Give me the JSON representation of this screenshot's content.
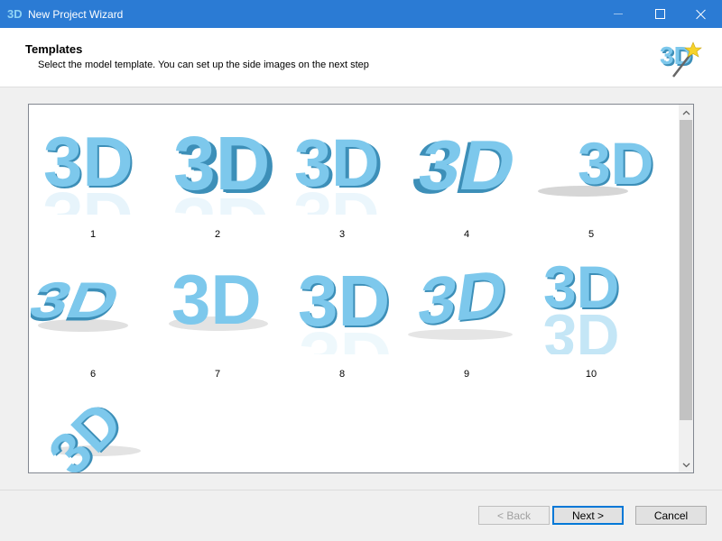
{
  "window": {
    "title": "New Project Wizard"
  },
  "header": {
    "title": "Templates",
    "subtitle": "Select the model template. You can set up the side images on the next step"
  },
  "templates": [
    {
      "label": "1",
      "style": "flat"
    },
    {
      "label": "2",
      "style": "deep-extrude"
    },
    {
      "label": "3",
      "style": "bold-extrude"
    },
    {
      "label": "4",
      "style": "perspective"
    },
    {
      "label": "5",
      "style": "tilted-shadow"
    },
    {
      "label": "6",
      "style": "lying"
    },
    {
      "label": "7",
      "style": "soft-shadow"
    },
    {
      "label": "8",
      "style": "plain"
    },
    {
      "label": "9",
      "style": "skewed"
    },
    {
      "label": "10",
      "style": "reflection"
    },
    {
      "label": "",
      "style": "rotated"
    }
  ],
  "buttons": {
    "back": "< Back",
    "next": "Next >",
    "cancel": "Cancel"
  },
  "colors": {
    "titlebar": "#2b7bd4",
    "face": "#7dc8ec",
    "side": "#3d8fb8",
    "accent": "#0078d7"
  }
}
